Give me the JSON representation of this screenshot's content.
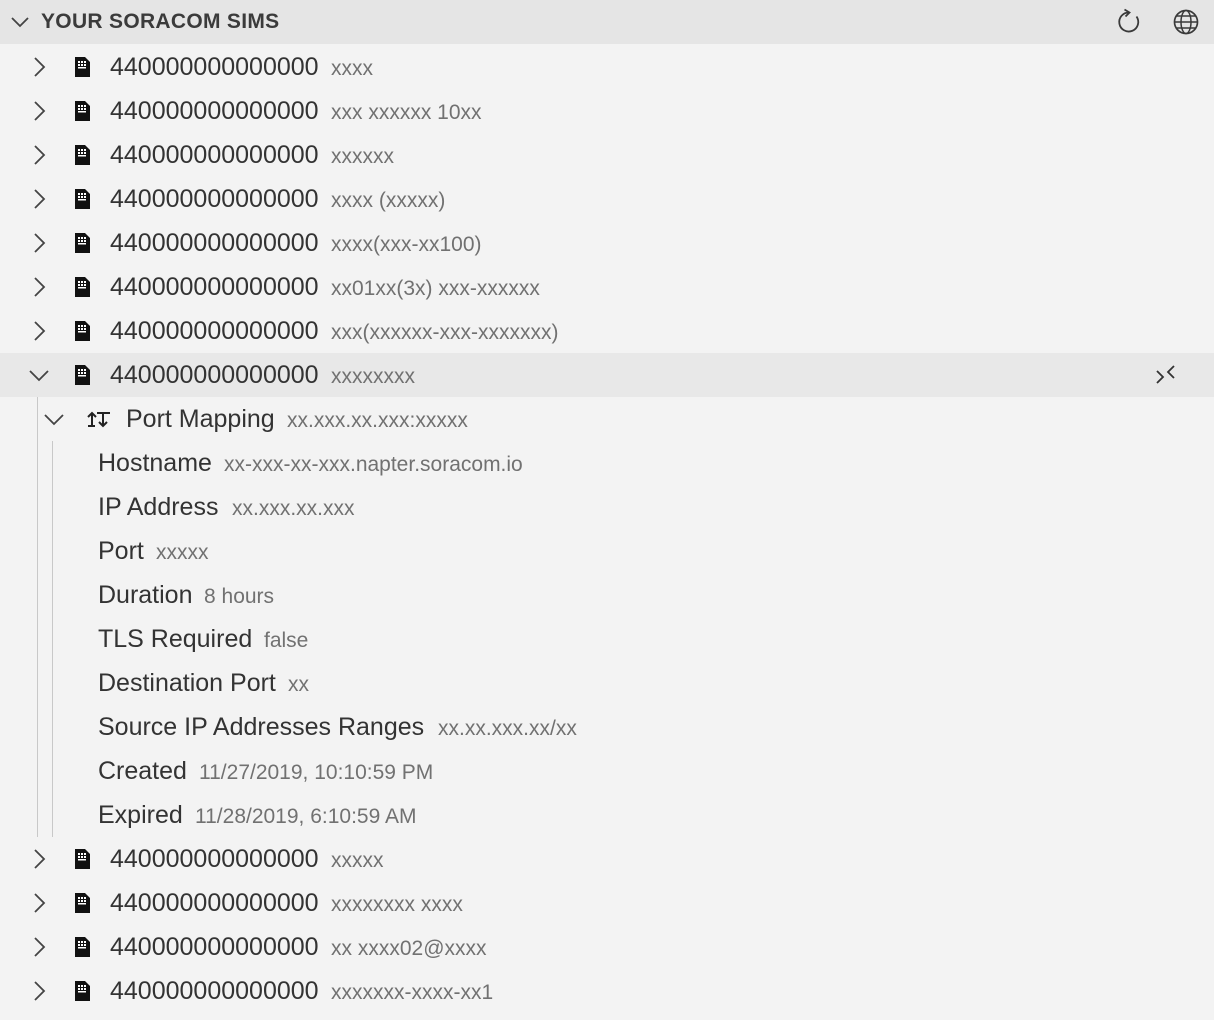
{
  "view": {
    "title": "YOUR SORACOM SIMS",
    "actions": [
      "refresh-icon",
      "globe-icon"
    ]
  },
  "sims_before": [
    {
      "imsi": "440000000000000",
      "desc": "xxxx"
    },
    {
      "imsi": "440000000000000",
      "desc": "xxx xxxxxx 10xx"
    },
    {
      "imsi": "440000000000000",
      "desc": "xxxxxx"
    },
    {
      "imsi": "440000000000000",
      "desc": "xxxx (xxxxx)"
    },
    {
      "imsi": "440000000000000",
      "desc": "xxxx(xxx-xx100)"
    },
    {
      "imsi": "440000000000000",
      "desc": "xx01xx(3x) xxx-xxxxxx"
    },
    {
      "imsi": "440000000000000",
      "desc": "xxx(xxxxxx-xxx-xxxxxxx)"
    }
  ],
  "expanded_sim": {
    "imsi": "440000000000000",
    "desc": "xxxxxxxx",
    "port_mapping": {
      "label": "Port Mapping",
      "desc": "xx.xxx.xx.xxx:xxxxx",
      "details": [
        {
          "key": "Hostname",
          "value": "xx-xxx-xx-xxx.napter.soracom.io"
        },
        {
          "key": "IP Address",
          "value": "xx.xxx.xx.xxx"
        },
        {
          "key": "Port",
          "value": "xxxxx"
        },
        {
          "key": "Duration",
          "value": "8 hours"
        },
        {
          "key": "TLS Required",
          "value": "false"
        },
        {
          "key": "Destination Port",
          "value": "xx"
        },
        {
          "key": "Source IP Addresses Ranges",
          "value": "xx.xx.xxx.xx/xx"
        },
        {
          "key": "Created",
          "value": "11/27/2019, 10:10:59 PM"
        },
        {
          "key": "Expired",
          "value": "11/28/2019, 6:10:59 AM"
        }
      ]
    }
  },
  "sims_after": [
    {
      "imsi": "440000000000000",
      "desc": "xxxxx"
    },
    {
      "imsi": "440000000000000",
      "desc": "xxxxxxxx xxxx"
    },
    {
      "imsi": "440000000000000",
      "desc": "xx xxxx02@xxxx"
    },
    {
      "imsi": "440000000000000",
      "desc": "xxxxxxx-xxxx-xx1"
    }
  ]
}
